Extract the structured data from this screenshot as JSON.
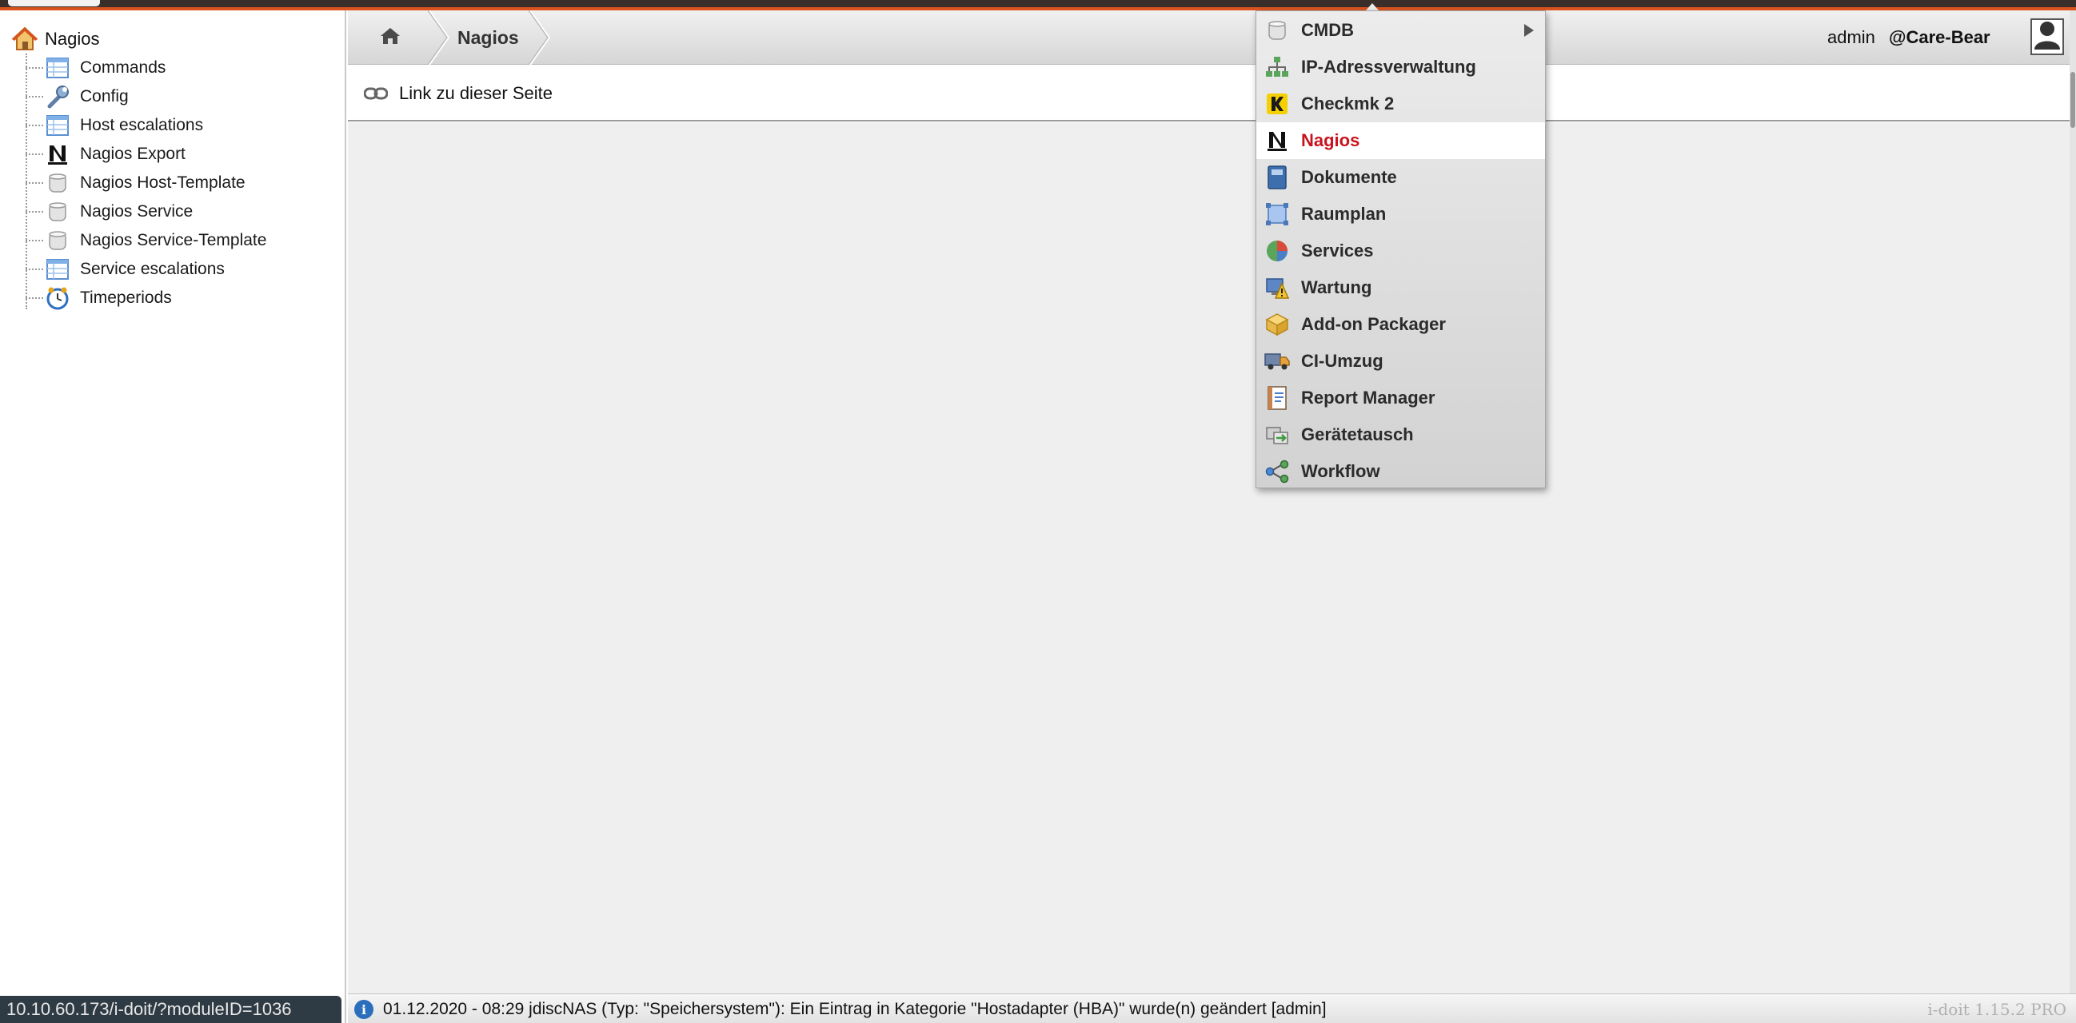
{
  "colors": {
    "accent": "#d9531e",
    "active_menu_text": "#c8141e",
    "info_icon": "#2a6ebc"
  },
  "sidebar": {
    "root": {
      "label": "Nagios",
      "icon": "home-icon"
    },
    "items": [
      {
        "label": "Commands",
        "icon": "table-icon"
      },
      {
        "label": "Config",
        "icon": "wrench-icon"
      },
      {
        "label": "Host escalations",
        "icon": "table-icon"
      },
      {
        "label": "Nagios Export",
        "icon": "nagios-n-icon"
      },
      {
        "label": "Nagios Host-Template",
        "icon": "database-icon"
      },
      {
        "label": "Nagios Service",
        "icon": "database-icon"
      },
      {
        "label": "Nagios Service-Template",
        "icon": "database-icon"
      },
      {
        "label": "Service escalations",
        "icon": "table-icon"
      },
      {
        "label": "Timeperiods",
        "icon": "clock-icon"
      }
    ]
  },
  "header": {
    "breadcrumb": [
      "Nagios"
    ],
    "user": "admin",
    "tenant": "@Care-Bear"
  },
  "toolbar": {
    "link_label": "Link zu dieser Seite"
  },
  "menu": {
    "items": [
      {
        "label": "CMDB",
        "icon": "database-icon",
        "has_submenu": true
      },
      {
        "label": "IP-Adressverwaltung",
        "icon": "network-icon"
      },
      {
        "label": "Checkmk 2",
        "icon": "checkmk-icon"
      },
      {
        "label": "Nagios",
        "icon": "nagios-n-icon",
        "active": true
      },
      {
        "label": "Dokumente",
        "icon": "book-icon"
      },
      {
        "label": "Raumplan",
        "icon": "floorplan-icon"
      },
      {
        "label": "Services",
        "icon": "pie-icon"
      },
      {
        "label": "Wartung",
        "icon": "maintenance-icon"
      },
      {
        "label": "Add-on Packager",
        "icon": "package-icon"
      },
      {
        "label": "CI-Umzug",
        "icon": "truck-icon"
      },
      {
        "label": "Report Manager",
        "icon": "report-icon"
      },
      {
        "label": "Gerätetausch",
        "icon": "swap-icon"
      },
      {
        "label": "Workflow",
        "icon": "workflow-icon"
      }
    ]
  },
  "statusbar": {
    "message": "01.12.2020 - 08:29 jdiscNAS (Typ: \"Speichersystem\"): Ein Eintrag in Kategorie \"Hostadapter (HBA)\" wurde(n) geändert [admin]",
    "version": "i-doit 1.15.2 PRO"
  },
  "url_tooltip": "10.10.60.173/i-doit/?moduleID=1036"
}
